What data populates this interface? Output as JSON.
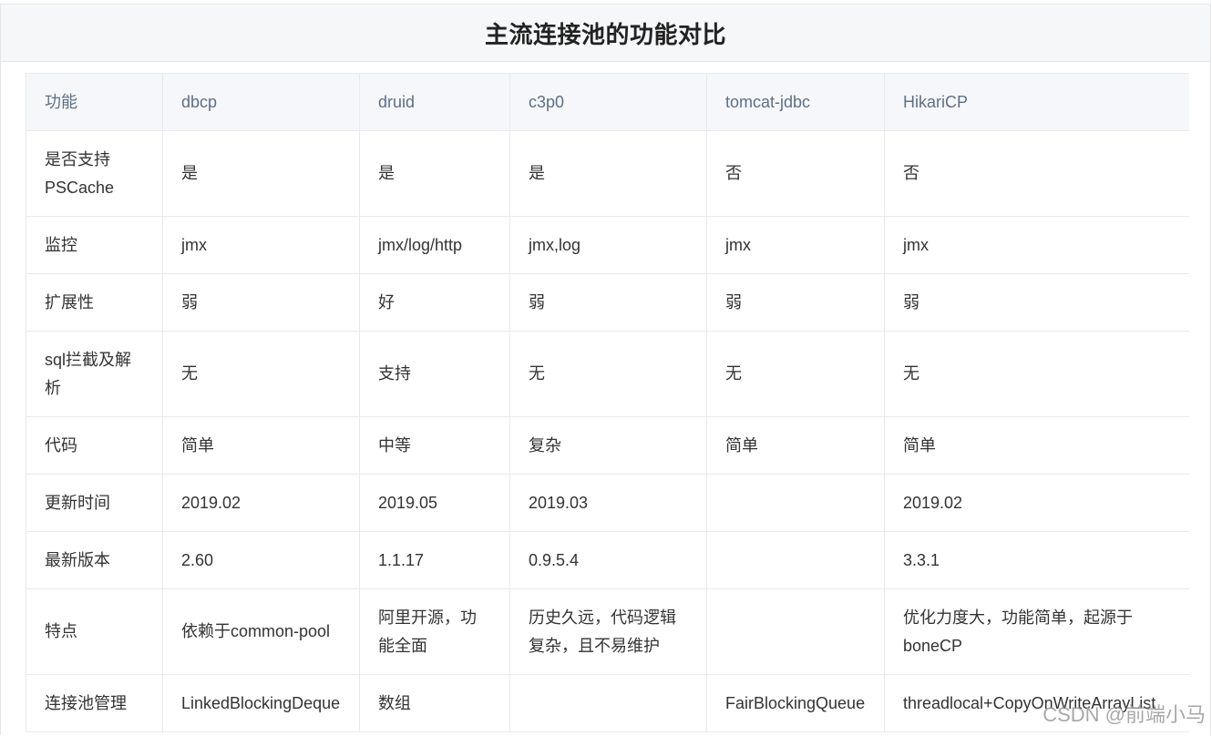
{
  "title": "主流连接池的功能对比",
  "table": {
    "headers": [
      "功能",
      "dbcp",
      "druid",
      "c3p0",
      "tomcat-jdbc",
      "HikariCP"
    ],
    "rows": [
      [
        "是否支持PSCache",
        "是",
        "是",
        "是",
        "否",
        "否"
      ],
      [
        "监控",
        "jmx",
        "jmx/log/http",
        "jmx,log",
        "jmx",
        "jmx"
      ],
      [
        "扩展性",
        "弱",
        "好",
        "弱",
        "弱",
        "弱"
      ],
      [
        "sql拦截及解析",
        "无",
        "支持",
        "无",
        "无",
        "无"
      ],
      [
        "代码",
        "简单",
        "中等",
        "复杂",
        "简单",
        "简单"
      ],
      [
        "更新时间",
        "2019.02",
        "2019.05",
        "2019.03",
        "",
        "2019.02"
      ],
      [
        "最新版本",
        "2.60",
        "1.1.17",
        "0.9.5.4",
        "",
        "3.3.1"
      ],
      [
        "特点",
        "依赖于common-pool",
        "阿里开源，功能全面",
        "历史久远，代码逻辑复杂，且不易维护",
        "",
        "优化力度大，功能简单，起源于boneCP"
      ],
      [
        "连接池管理",
        "LinkedBlockingDeque",
        "数组",
        "",
        "FairBlockingQueue",
        "threadlocal+CopyOnWriteArrayList"
      ]
    ]
  },
  "watermark": "CSDN @前端小马"
}
